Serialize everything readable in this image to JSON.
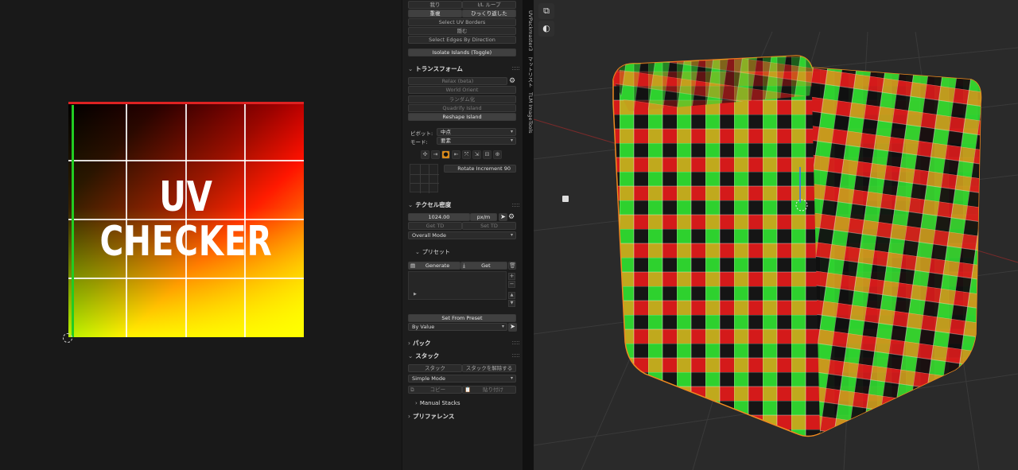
{
  "uv_editor": {
    "texture_line1": "UV",
    "texture_line2": "CHECKER"
  },
  "panel": {
    "top_buttons": [
      [
        "我り",
        "I/L ループ"
      ],
      [
        "重複",
        "ひっくり返した"
      ]
    ],
    "select_uv_borders": "Select UV Borders",
    "hide": "隠む",
    "select_edges_by_direction": "Select Edges By Direction",
    "isolate_islands": "Isolate Islands (Toggle)",
    "transform": {
      "header": "トランスフォーム",
      "relax": "Relax (beta)",
      "world_orient": "World Orient",
      "randomize": "ランダム化",
      "quadrify": "Quadrify Island",
      "reshape": "Reshape Island",
      "pivot_label": "ピボット:",
      "pivot_value": "中点",
      "mode_label": "モード:",
      "mode_value": "要素",
      "rotate_increment_label": "Rotate Increment",
      "rotate_increment_value": "90"
    },
    "texel": {
      "header": "テクセル密度",
      "value": "1024.00",
      "unit": "px/m",
      "get_td": "Get TD",
      "set_td": "Set TD",
      "mode": "Overall Mode",
      "preset_header": "プリセット",
      "generate": "Generate",
      "get": "Get",
      "set_from_preset": "Set From Preset",
      "by_value": "By Value"
    },
    "pack": {
      "header": "パック"
    },
    "stack": {
      "header": "スタック",
      "stack_btn": "スタック",
      "unstack_btn": "スタックを解除する",
      "mode": "Simple Mode",
      "copy": "コピー",
      "paste": "貼り付け",
      "manual_stacks": "Manual Stacks"
    },
    "preferences": {
      "header": "プリファレンス"
    }
  },
  "tabs": [
    "UVPackmaster3",
    "マットリスト",
    "TLM ImageTools"
  ],
  "colors": {
    "accent": "#d98a1b",
    "panel_bg": "#1d1d1d",
    "viewport_bg": "#2a2a2a"
  }
}
